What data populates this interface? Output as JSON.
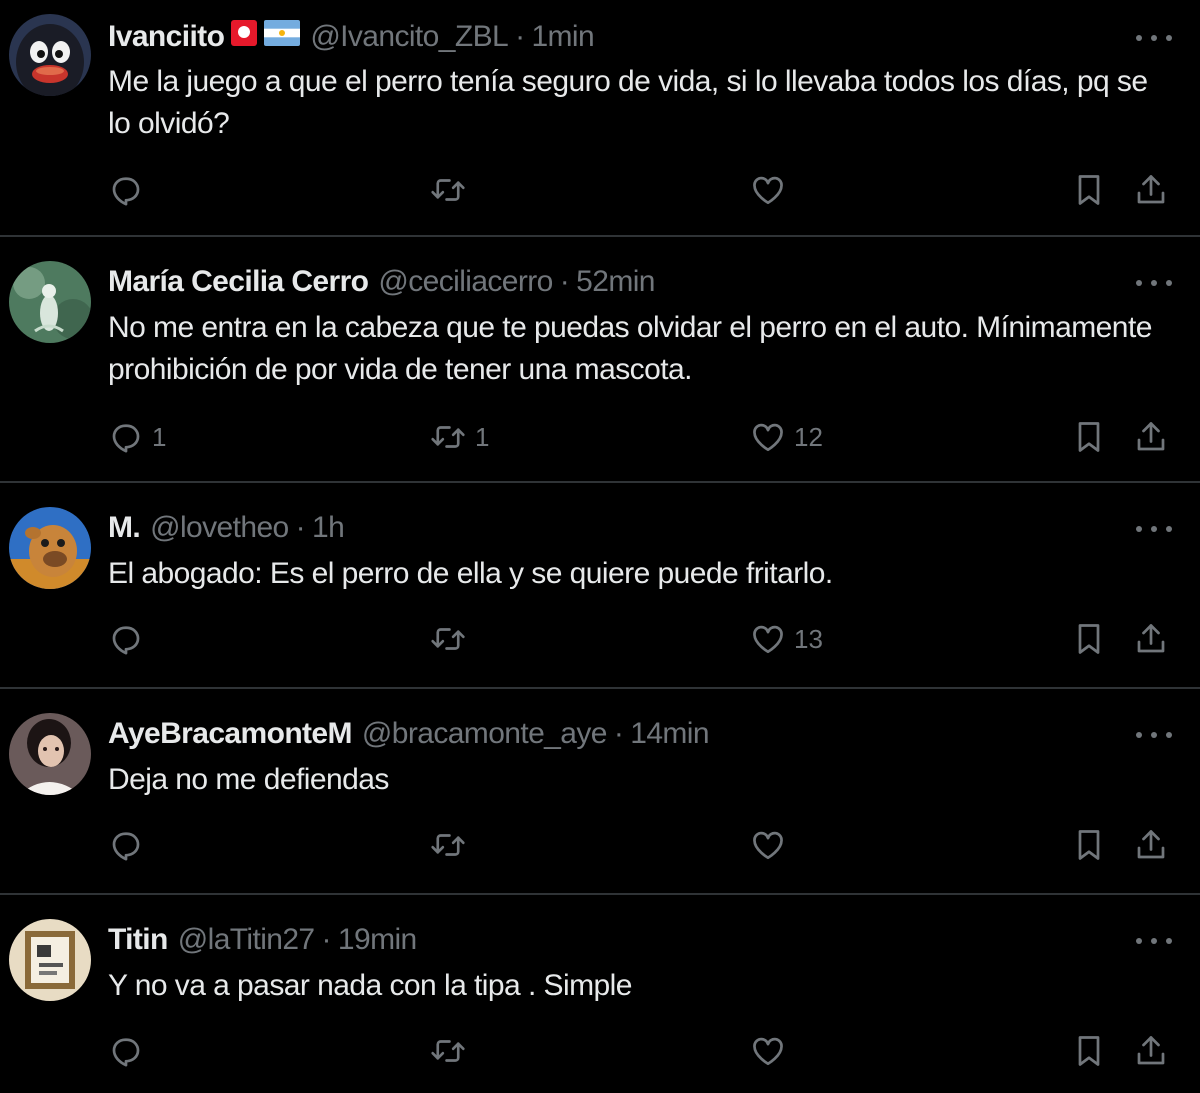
{
  "tweets": [
    {
      "display_name": "Ivanciito",
      "handle": "@Ivancito_ZBL",
      "separator": "·",
      "time": "1min",
      "text": "Me la juego a que el perro tenía seguro de vida, si lo llevaba todos los días, pq se lo olvidó?",
      "reply_count": "",
      "retweet_count": "",
      "like_count": "",
      "flags": [
        "red-square-emoji",
        "argentina-flag-emoji"
      ]
    },
    {
      "display_name": "María Cecilia Cerro",
      "handle": "@ceciliacerro",
      "separator": "·",
      "time": "52min",
      "text": "No me entra en la cabeza que te puedas olvidar el perro en el auto. Mínimamente prohibición de por vida de tener una mascota.",
      "reply_count": "1",
      "retweet_count": "1",
      "like_count": "12"
    },
    {
      "display_name": "M.",
      "handle": "@lovetheo",
      "separator": "·",
      "time": "1h",
      "text": "El abogado: Es el perro de ella y se quiere puede fritarlo.",
      "reply_count": "",
      "retweet_count": "",
      "like_count": "13"
    },
    {
      "display_name": "AyeBracamonteM",
      "handle": "@bracamonte_aye",
      "separator": "·",
      "time": "14min",
      "text": "Deja no me defiendas",
      "reply_count": "",
      "retweet_count": "",
      "like_count": ""
    },
    {
      "display_name": "Titin",
      "handle": "@laTitin27",
      "separator": "·",
      "time": "19min",
      "text": "Y no va a pasar nada con la tipa . Simple",
      "reply_count": "",
      "retweet_count": "",
      "like_count": ""
    }
  ],
  "icons": {
    "reply": "reply-icon",
    "retweet": "retweet-icon",
    "like": "heart-icon",
    "bookmark": "bookmark-icon",
    "share": "share-icon",
    "more": "more-icon"
  },
  "colors": {
    "background": "#000000",
    "primary_text": "#e7e9ea",
    "secondary_text": "#71767b",
    "divider": "#2f3336"
  }
}
